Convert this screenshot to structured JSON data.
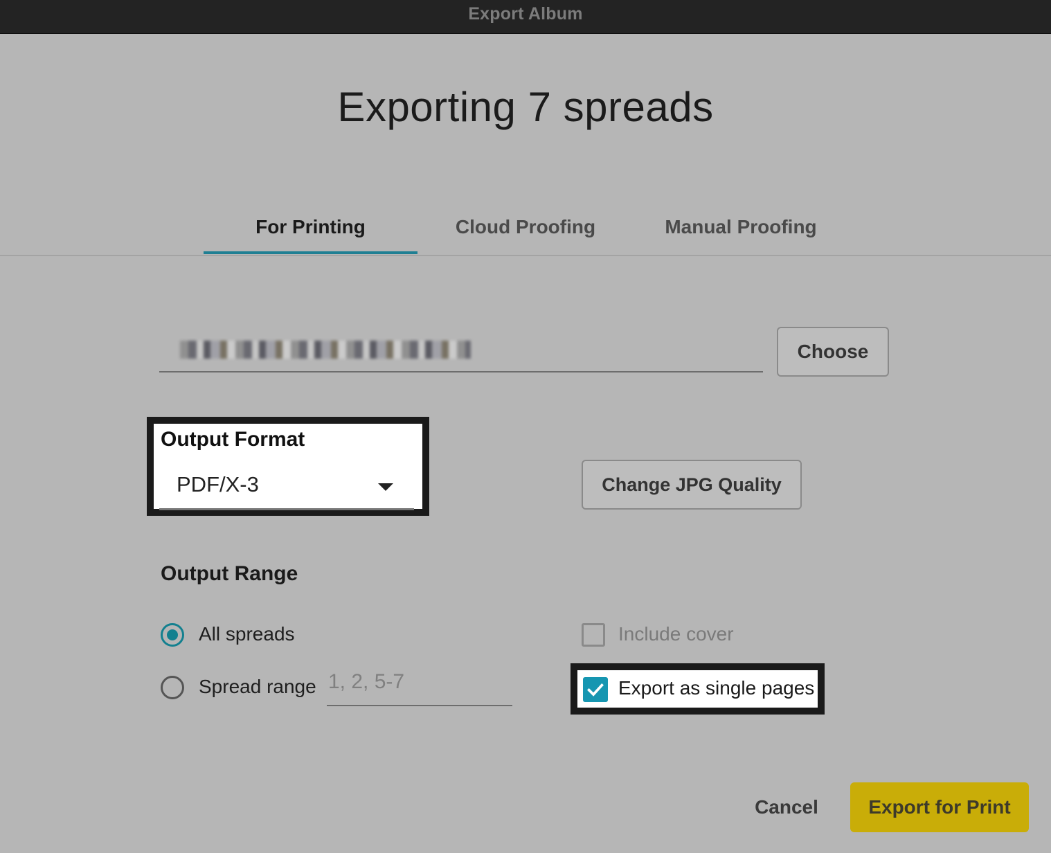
{
  "window": {
    "title": "Export Album"
  },
  "heading": "Exporting 7 spreads",
  "tabs": [
    {
      "label": "For Printing",
      "active": true
    },
    {
      "label": "Cloud Proofing",
      "active": false
    },
    {
      "label": "Manual Proofing",
      "active": false
    }
  ],
  "destination": {
    "choose_label": "Choose"
  },
  "output_format": {
    "label": "Output Format",
    "selected": "PDF/X-3",
    "change_jpg_label": "Change JPG Quality"
  },
  "output_range": {
    "title": "Output Range",
    "all_spreads_label": "All spreads",
    "all_spreads_selected": true,
    "spread_range_label": "Spread range",
    "spread_range_placeholder": "1, 2, 5-7",
    "include_cover_label": "Include cover",
    "include_cover_checked": false,
    "single_pages_label": "Export as single pages",
    "single_pages_checked": true
  },
  "footer": {
    "cancel_label": "Cancel",
    "export_label": "Export for Print"
  },
  "colors": {
    "accent": "#1f7f93",
    "checkbox_checked": "#1696b1",
    "primary_button": "#c9ad08",
    "background": "#b6b6b6"
  }
}
